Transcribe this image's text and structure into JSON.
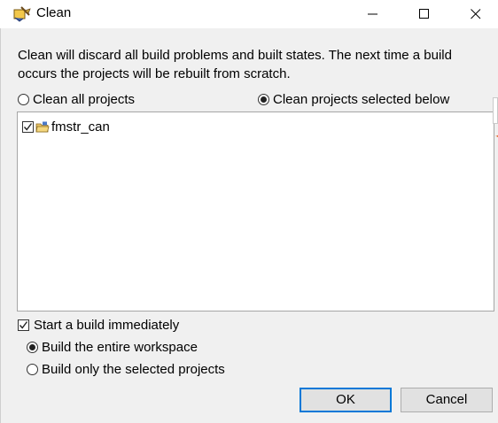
{
  "window": {
    "title": "Clean",
    "icon": "clean-broom-icon",
    "controls": [
      "minimize-icon",
      "maximize-icon",
      "close-icon"
    ]
  },
  "description": "Clean will discard all build problems and built states.  The next time a build occurs the projects will be rebuilt from scratch.",
  "scope": {
    "clean_all_label": "Clean all projects",
    "clean_all_selected": false,
    "clean_selected_label": "Clean projects selected below",
    "clean_selected_selected": true
  },
  "projects": [
    {
      "name": "fmstr_can",
      "checked": true,
      "icon": "project-folder-icon"
    }
  ],
  "build": {
    "start_label": "Start a build immediately",
    "start_checked": true,
    "entire_label": "Build the entire workspace",
    "entire_selected": true,
    "selected_label": "Build only the selected projects",
    "selected_selected": false
  },
  "buttons": {
    "ok": "OK",
    "cancel": "Cancel"
  },
  "colors": {
    "accent": "#0078d7",
    "background": "#f0f0f0"
  }
}
